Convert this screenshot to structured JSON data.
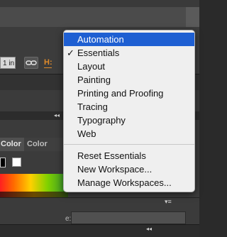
{
  "toolbar": {
    "unit_value": "1 in",
    "h_label": "H:"
  },
  "panels": {
    "tab_color": "Color",
    "tab_color_guide": "Color Guide",
    "bottom_field_label": "e:"
  },
  "workspace_menu": {
    "items": [
      {
        "label": "Automation",
        "highlighted": true,
        "checked": false
      },
      {
        "label": "Essentials",
        "highlighted": false,
        "checked": true
      },
      {
        "label": "Layout",
        "highlighted": false,
        "checked": false
      },
      {
        "label": "Painting",
        "highlighted": false,
        "checked": false
      },
      {
        "label": "Printing and Proofing",
        "highlighted": false,
        "checked": false
      },
      {
        "label": "Tracing",
        "highlighted": false,
        "checked": false
      },
      {
        "label": "Typography",
        "highlighted": false,
        "checked": false
      },
      {
        "label": "Web",
        "highlighted": false,
        "checked": false
      }
    ],
    "actions": [
      {
        "label": "Reset Essentials"
      },
      {
        "label": "New Workspace..."
      },
      {
        "label": "Manage Workspaces..."
      }
    ],
    "check_glyph": "✓",
    "highlight_color": "#1e5fd2"
  }
}
